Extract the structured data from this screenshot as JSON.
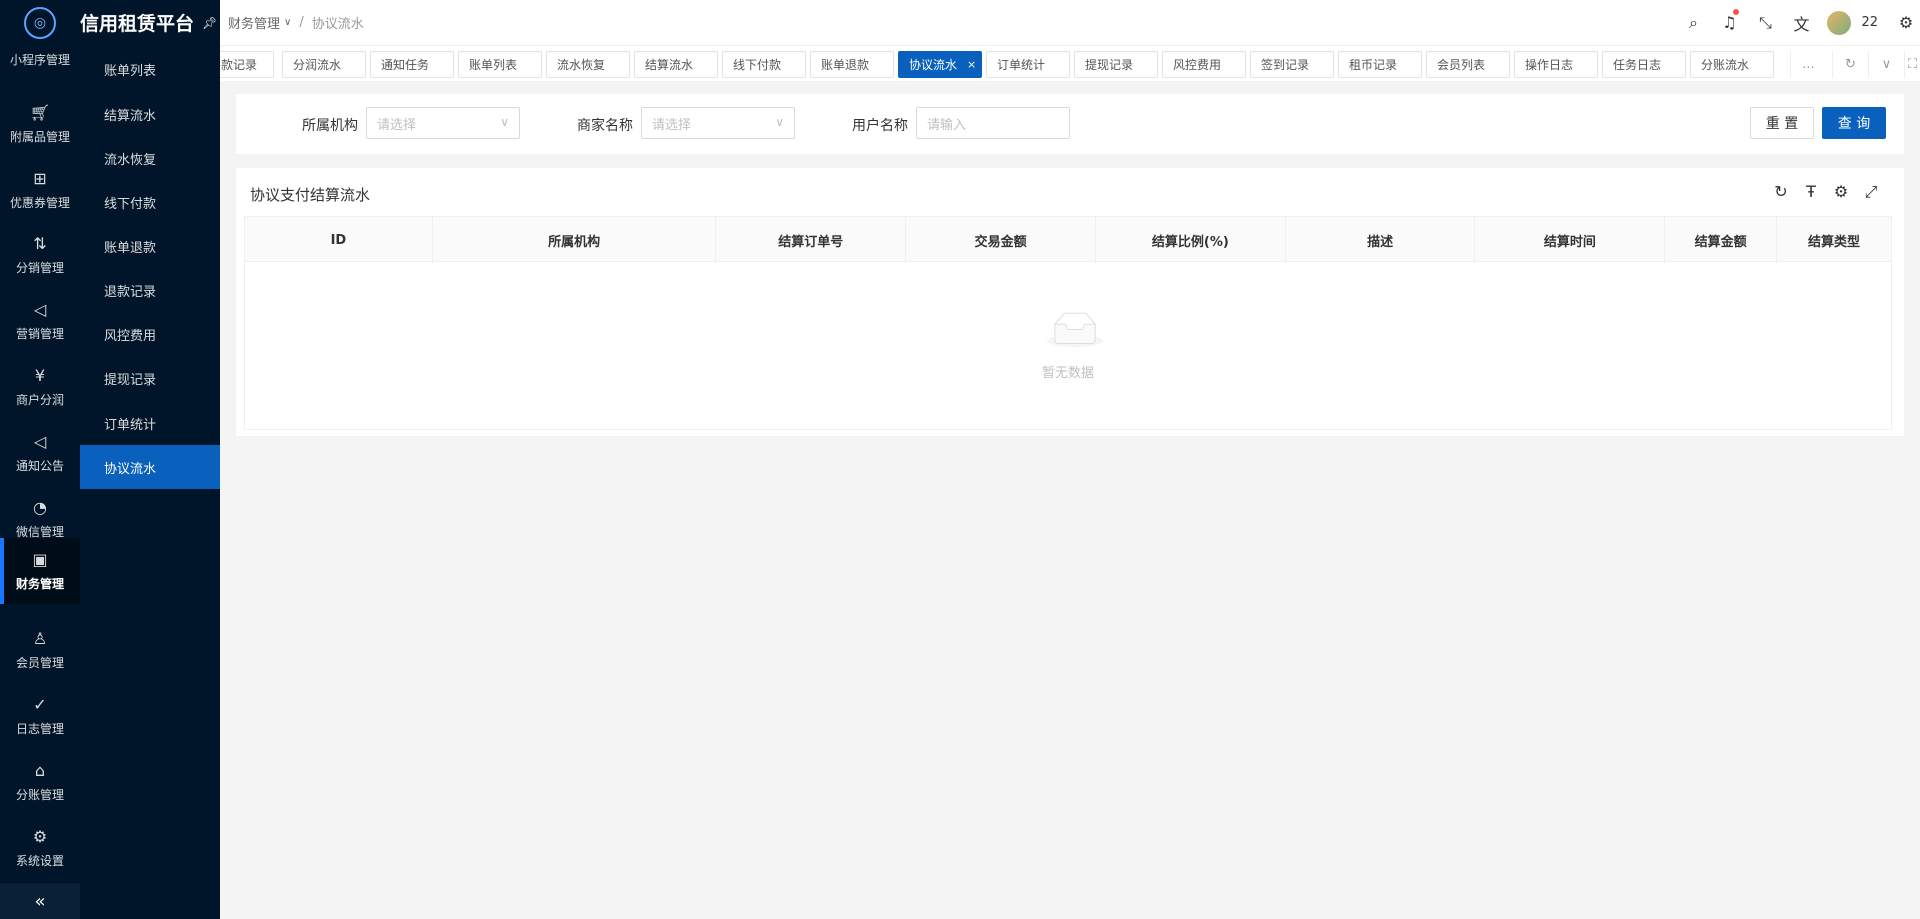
{
  "brand": {
    "title": "信用租赁平台"
  },
  "rail": {
    "items": [
      {
        "label": "小程序管理",
        "icon": "miniapp-icon"
      },
      {
        "label": "附属品管理",
        "icon": "cart-icon"
      },
      {
        "label": "优惠券管理",
        "icon": "gift-icon"
      },
      {
        "label": "分销管理",
        "icon": "distribution-icon"
      },
      {
        "label": "营销管理",
        "icon": "megaphone-icon"
      },
      {
        "label": "商户分润",
        "icon": "yen-icon"
      },
      {
        "label": "通知公告",
        "icon": "notice-icon"
      },
      {
        "label": "微信管理",
        "icon": "wechat-icon"
      },
      {
        "label": "财务管理",
        "icon": "finance-icon"
      },
      {
        "label": "会员管理",
        "icon": "member-icon"
      },
      {
        "label": "日志管理",
        "icon": "log-icon"
      },
      {
        "label": "分账管理",
        "icon": "split-icon"
      },
      {
        "label": "系统设置",
        "icon": "gear-icon"
      }
    ],
    "collapse": "«"
  },
  "submenu": {
    "items": [
      "账单列表",
      "结算流水",
      "流水恢复",
      "线下付款",
      "账单退款",
      "退款记录",
      "风控费用",
      "提现记录",
      "订单统计",
      "协议流水"
    ],
    "active": "协议流水"
  },
  "header": {
    "breadcrumb": {
      "parent": "财务管理",
      "separator": "/",
      "current": "协议流水"
    },
    "user": "22"
  },
  "tabs": {
    "items": [
      "款记录",
      "分润流水",
      "通知任务",
      "账单列表",
      "流水恢复",
      "结算流水",
      "线下付款",
      "账单退款",
      "协议流水",
      "订单统计",
      "提现记录",
      "风控费用",
      "签到记录",
      "租币记录",
      "会员列表",
      "操作日志",
      "任务日志",
      "分账流水"
    ],
    "active": "协议流水",
    "more": "..."
  },
  "search": {
    "org_label": "所属机构",
    "org_placeholder": "请选择",
    "merchant_label": "商家名称",
    "merchant_placeholder": "请选择",
    "user_label": "用户名称",
    "user_placeholder": "请输入",
    "reset": "重 置",
    "query": "查 询"
  },
  "table": {
    "title": "协议支付结算流水",
    "columns": [
      "ID",
      "所属机构",
      "结算订单号",
      "交易金额",
      "结算比例(%)",
      "描述",
      "结算时间",
      "结算金额",
      "结算类型"
    ],
    "empty": "暂无数据"
  },
  "colors": {
    "primary": "#0960bd",
    "sidebar": "#001529"
  }
}
